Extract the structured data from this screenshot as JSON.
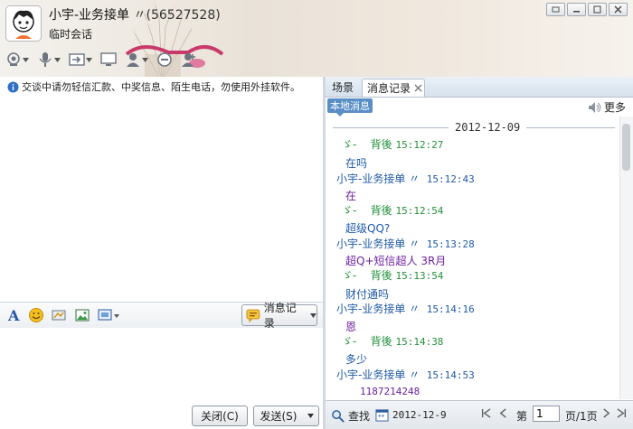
{
  "title_bar": {
    "contact_name": "小宇-业务接单",
    "contact_qq": "〃(56527528)",
    "status": "临时会话"
  },
  "notice": "交谈中请勿轻信汇款、中奖信息、陌生电话，勿使用外挂软件。",
  "format_bar": {
    "history_button": "消息记录"
  },
  "actions": {
    "close": "关闭(C)",
    "send": "发送(S)"
  },
  "history_panel": {
    "tabs": [
      "场景",
      "消息记录"
    ],
    "local_tag": "本地消息",
    "more": "更多",
    "date": "2012-12-09",
    "messages": [
      {
        "kind": "me",
        "sender": "ゞ-",
        "alias": "背後",
        "time": "15:12:27",
        "text": "在吗"
      },
      {
        "kind": "other",
        "sender": "小宇-业务接单 〃",
        "time": "15:12:43",
        "text": "在"
      },
      {
        "kind": "me",
        "sender": "ゞ-",
        "alias": "背後",
        "time": "15:12:54",
        "text": "超级QQ?"
      },
      {
        "kind": "other",
        "sender": "小宇-业务接单 〃",
        "time": "15:13:28",
        "text": "超Q+短信超人 3R月"
      },
      {
        "kind": "me",
        "sender": "ゞ-",
        "alias": "背後",
        "time": "15:13:54",
        "text": "财付通吗"
      },
      {
        "kind": "other",
        "sender": "小宇-业务接单 〃",
        "time": "15:14:16",
        "text": "恩"
      },
      {
        "kind": "me",
        "sender": "ゞ-",
        "alias": "背後",
        "time": "15:14:38",
        "text": "多少"
      },
      {
        "kind": "other",
        "sender": "小宇-业务接单 〃",
        "time": "15:14:53",
        "text": "1187214248"
      }
    ],
    "bottom": {
      "search": "查找",
      "date_value": "2012-12-9",
      "page_label": "第",
      "page_value": "1",
      "page_total": "页/1页"
    }
  },
  "colors": {
    "accent_blue": "#5a8ec6",
    "my_name": "#22913b",
    "other_name": "#1f5aa8",
    "other_text": "#6b1fa0"
  }
}
